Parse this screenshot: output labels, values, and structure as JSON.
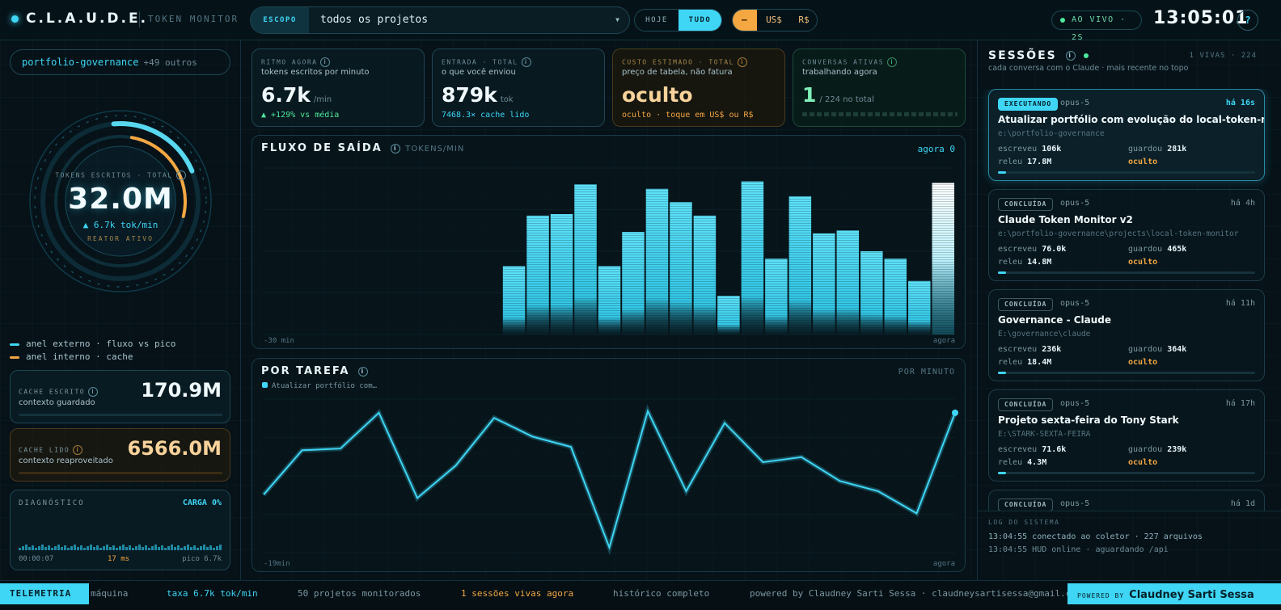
{
  "header": {
    "logo": "C.L.A.U.D.E.",
    "subtitle": "TOKEN MONITOR",
    "scope_label": "ESCOPO",
    "scope_value": "todos os projetos",
    "range_toggle": [
      "HOJE",
      "TUDO"
    ],
    "currency_toggle": [
      "—",
      "US$",
      "R$"
    ],
    "live_label": "AO VIVO · 2S",
    "clock": "13:05:01",
    "help": "?"
  },
  "left": {
    "project_chip": "portfolio-governance",
    "project_more": "+49 outros",
    "gauge": {
      "label": "TOKENS ESCRITOS · TOTAL",
      "value": "32.0M",
      "rate": "▲ 6.7k tok/min",
      "status": "REATOR ATIVO",
      "outer_ring_fraction": 0.2,
      "inner_ring_fraction": 0.26
    },
    "legend": [
      {
        "label": "anel externo · fluxo vs pico",
        "color": "#3fd6f5"
      },
      {
        "label": "anel interno · cache",
        "color": "#f5a742"
      }
    ],
    "cache_written": {
      "label": "CACHE ESCRITO",
      "sub": "contexto guardado",
      "value": "170.9M"
    },
    "cache_read": {
      "label": "CACHE LIDO",
      "sub": "contexto reaproveitado",
      "value": "6566.0M"
    },
    "diagnostics": {
      "label": "DIAGNÓSTICO",
      "load": "CARGA 0%",
      "start": "00:00:07",
      "latency": "17 ms",
      "peak": "pico 6.7k"
    }
  },
  "kpis": [
    {
      "label": "RITMO AGORA",
      "sub": "tokens escritos por minuto",
      "value": "6.7k",
      "unit": "/min",
      "foot": "▲ +129% vs média",
      "foot_color": "#4ee89a",
      "variant": ""
    },
    {
      "label": "ENTRADA · TOTAL",
      "sub": "o que você enviou",
      "value": "879k",
      "unit": "tok",
      "foot": "7468.3× cache lido",
      "foot_color": "#3fd6f5",
      "variant": ""
    },
    {
      "label": "CUSTO ESTIMADO · TOTAL",
      "sub": "preço de tabela, não fatura",
      "value": "oculto",
      "unit": "",
      "foot": "oculto · toque em US$ ou R$",
      "foot_color": "#f5a742",
      "variant": "amber"
    },
    {
      "label": "CONVERSAS ATIVAS",
      "sub": "trabalhando agora",
      "value": "1",
      "unit": "/ 224 no total",
      "foot": "",
      "foot_color": "#4ee89a",
      "variant": "green"
    }
  ],
  "flow": {
    "title": "FLUXO DE SAÍDA",
    "tag": "TOKENS/MIN",
    "now": "agora 0",
    "x_start": "-30 min",
    "x_end": "agora"
  },
  "task": {
    "title": "POR TAREFA",
    "tag": "POR MINUTO",
    "legend": "Atualizar portfólio com…",
    "x_start": "-19min",
    "x_end": "agora"
  },
  "chart_data": [
    {
      "type": "bar",
      "title": "FLUXO DE SAÍDA",
      "values": [
        0,
        0,
        0,
        0,
        0,
        0,
        0,
        0,
        0,
        0,
        2.3,
        4.0,
        4.05,
        5.05,
        2.3,
        3.45,
        4.9,
        4.45,
        4.0,
        1.3,
        5.15,
        2.55,
        4.65,
        3.4,
        3.5,
        2.8,
        2.55,
        1.8,
        5.1
      ],
      "ylim": [
        0,
        5.6
      ],
      "xlabel_start": "-30 min",
      "xlabel_end": "agora"
    },
    {
      "type": "line",
      "title": "POR TAREFA",
      "series": [
        {
          "name": "Atualizar portfólio com…",
          "values": [
            1.7,
            3.0,
            3.05,
            4.1,
            1.6,
            2.55,
            3.95,
            3.4,
            3.1,
            0.15,
            4.15,
            1.8,
            3.8,
            2.65,
            2.8,
            2.1,
            1.8,
            1.15,
            4.1
          ]
        }
      ],
      "ylim": [
        0,
        4.5
      ]
    }
  ],
  "sessions_panel": {
    "title": "SESSÕES",
    "counts": "1 VIVAS · 224",
    "sub": "cada conversa com o Claude · mais recente no topo",
    "log_label": "LOG DO SISTEMA",
    "log": [
      "13:04:55 conectado ao coletor · 227 arquivos",
      "13:04:55 HUD online · aguardando /api"
    ]
  },
  "sessions": [
    {
      "badge": "EXECUTANDO",
      "model": "opus-5",
      "when": "há 16s",
      "title": "Atualizar portfólio com evolução do local-token-monitor",
      "path": "e:\\portfolio-governance",
      "wrote_label": "escreveu",
      "wrote": "106k",
      "saved_label": "guardou",
      "saved": "281k",
      "reread_label": "releu",
      "reread": "17.8M",
      "cost": "oculto",
      "progress": 0.03,
      "active": true
    },
    {
      "badge": "CONCLUÍDA",
      "model": "opus-5",
      "when": "há 4h",
      "title": "Claude Token Monitor v2",
      "path": "e:\\portfolio-governance\\projects\\local-token-monitor",
      "wrote_label": "escreveu",
      "wrote": "76.0k",
      "saved_label": "guardou",
      "saved": "465k",
      "reread_label": "releu",
      "reread": "14.8M",
      "cost": "oculto",
      "progress": 0.03,
      "active": false
    },
    {
      "badge": "CONCLUÍDA",
      "model": "opus-5",
      "when": "há 11h",
      "title": "Governance - Claude",
      "path": "E:\\governance\\claude",
      "wrote_label": "escreveu",
      "wrote": "236k",
      "saved_label": "guardou",
      "saved": "364k",
      "reread_label": "releu",
      "reread": "18.4M",
      "cost": "oculto",
      "progress": 0.03,
      "active": false
    },
    {
      "badge": "CONCLUÍDA",
      "model": "opus-5",
      "when": "há 17h",
      "title": "Projeto sexta-feira do Tony Stark",
      "path": "E:\\STARK-SEXTA-FEIRA",
      "wrote_label": "escreveu",
      "wrote": "71.6k",
      "saved_label": "guardou",
      "saved": "239k",
      "reread_label": "releu",
      "reread": "4.3M",
      "cost": "oculto",
      "progress": 0.03,
      "active": false
    },
    {
      "badge": "CONCLUÍDA",
      "model": "opus-5",
      "when": "há 1d",
      "title": "",
      "path": "",
      "wrote_label": "",
      "wrote": "",
      "saved_label": "",
      "saved": "",
      "reread_label": "",
      "reread": "",
      "cost": "",
      "progress": 0,
      "active": false
    }
  ],
  "footer": {
    "telemetry": "TELEMETRIA",
    "items": [
      {
        "text": "máquina",
        "color": "#7c98a2"
      },
      {
        "text": "taxa 6.7k tok/min",
        "color": "#3fd6f5"
      },
      {
        "text": "50 projetos monitorados",
        "color": "#7c98a2"
      },
      {
        "text": "1 sessões vivas agora",
        "color": "#f5a742"
      },
      {
        "text": "histórico completo",
        "color": "#7c98a2"
      },
      {
        "text": "powered by Claudney Sarti Sessa · claudneysartisessa@gmail.c",
        "color": "#7c98a2"
      }
    ],
    "powered_label": "POWERED BY",
    "powered_name": "Claudney Sarti Sessa"
  }
}
